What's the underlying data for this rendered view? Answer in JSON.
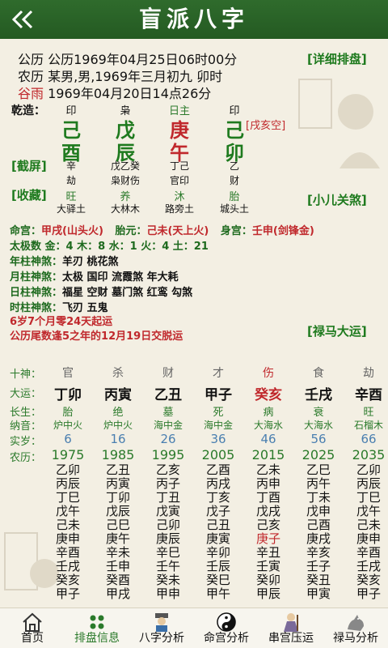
{
  "header": {
    "title": "盲派八字"
  },
  "info": {
    "gregorian_label": "公历",
    "gregorian_value": "公历1969年04月25日06时00分",
    "lunar_label": "农历",
    "lunar_value": "某男,男,1969年三月初九 卯时",
    "term_label": "谷雨",
    "term_value": "1969年04月20日14点26分",
    "detail_button": "[详细排盘]"
  },
  "chart": {
    "qianzao": "乾造：",
    "ten_gods_top": [
      "印",
      "枭",
      "日主",
      "印"
    ],
    "stems": [
      "己",
      "戊",
      "庚",
      "己"
    ],
    "branches": [
      "酉",
      "辰",
      "午",
      "卯"
    ],
    "kongwang": "[戌亥空]",
    "jieping": "[截屏]",
    "shoucang": "[收藏]",
    "hidden_stems": [
      "辛",
      "戊乙癸",
      "丁己",
      "乙"
    ],
    "hidden_gods": [
      "劫",
      "枭财伤",
      "官印",
      "财"
    ],
    "states": [
      "旺",
      "养",
      "沐",
      "胎"
    ],
    "nayin": [
      "大驿土",
      "大林木",
      "路旁土",
      "城头土"
    ],
    "xiaoer_button": "[小儿关煞]"
  },
  "palaces": {
    "minggong_label": "命宫：",
    "minggong": "甲戌(山头火)",
    "taiyuan_label": "胎元：",
    "taiyuan": "己未(天上火)",
    "shengong_label": "身宫：",
    "shengong": "壬申(剑锋金)"
  },
  "elements": "太极数 金：4 木：8 水：1 火：4 土：21",
  "shensha": [
    {
      "label": "年柱神煞：",
      "value": "羊刃 桃花煞"
    },
    {
      "label": "月柱神煞：",
      "value": "太极 国印 流霞煞 年大耗"
    },
    {
      "label": "日柱神煞：",
      "value": "福星 空财 墓门煞 红鸾 勾煞"
    },
    {
      "label": "时柱神煞：",
      "value": "飞刃 五鬼"
    }
  ],
  "qiyun": "6岁7个月零24天起运",
  "jiaoyun": "公历尾数逢5之年的12月19日交脱运",
  "luma_button": "[禄马大运]",
  "dayun": {
    "labels": [
      "十神：",
      "大运：",
      "长生：",
      "纳音：",
      "实岁：",
      "农历："
    ],
    "columns": [
      {
        "god": "官",
        "pillar": "丁卯",
        "state": "胎",
        "nayin": "炉中火",
        "age": "6",
        "year": "1975",
        "years": [
          "乙卯",
          "丙辰",
          "丁巳",
          "戊午",
          "己未",
          "庚申",
          "辛酉",
          "壬戌",
          "癸亥",
          "甲子"
        ]
      },
      {
        "god": "杀",
        "pillar": "丙寅",
        "state": "绝",
        "nayin": "炉中火",
        "age": "16",
        "year": "1985",
        "years": [
          "乙丑",
          "丙寅",
          "丁卯",
          "戊辰",
          "己巳",
          "庚午",
          "辛未",
          "壬申",
          "癸酉",
          "甲戌"
        ]
      },
      {
        "god": "财",
        "pillar": "乙丑",
        "state": "墓",
        "nayin": "海中金",
        "age": "26",
        "year": "1995",
        "years": [
          "乙亥",
          "丙子",
          "丁丑",
          "戊寅",
          "己卯",
          "庚辰",
          "辛巳",
          "壬午",
          "癸未",
          "甲申"
        ]
      },
      {
        "god": "才",
        "pillar": "甲子",
        "state": "死",
        "nayin": "海中金",
        "age": "36",
        "year": "2005",
        "years": [
          "乙酉",
          "丙戌",
          "丁亥",
          "戊子",
          "己丑",
          "庚寅",
          "辛卯",
          "壬辰",
          "癸巳",
          "甲午"
        ]
      },
      {
        "god": "伤",
        "pillar": "癸亥",
        "state": "病",
        "nayin": "大海水",
        "age": "46",
        "year": "2015",
        "years": [
          "乙未",
          "丙申",
          "丁酉",
          "戊戌",
          "己亥",
          "庚子",
          "辛丑",
          "壬寅",
          "癸卯",
          "甲辰"
        ]
      },
      {
        "god": "食",
        "pillar": "壬戌",
        "state": "衰",
        "nayin": "大海水",
        "age": "56",
        "year": "2025",
        "years": [
          "乙巳",
          "丙午",
          "丁未",
          "戊申",
          "己酉",
          "庚戌",
          "辛亥",
          "壬子",
          "癸丑",
          "甲寅"
        ]
      },
      {
        "god": "劫",
        "pillar": "辛酉",
        "state": "旺",
        "nayin": "石榴木",
        "age": "66",
        "year": "2035",
        "years": [
          "乙卯",
          "丙辰",
          "丁巳",
          "戊午",
          "己未",
          "庚申",
          "辛酉",
          "壬戌",
          "癸亥",
          "甲子"
        ]
      }
    ]
  },
  "tabs": [
    "首页",
    "排盘信息",
    "八字分析",
    "命宫分析",
    "串宫压运",
    "禄马分析"
  ],
  "colors": {
    "header": "#2f6b2c",
    "accent_green": "#2b7a2b",
    "accent_red": "#c0282c",
    "background": "#f3efe3"
  }
}
